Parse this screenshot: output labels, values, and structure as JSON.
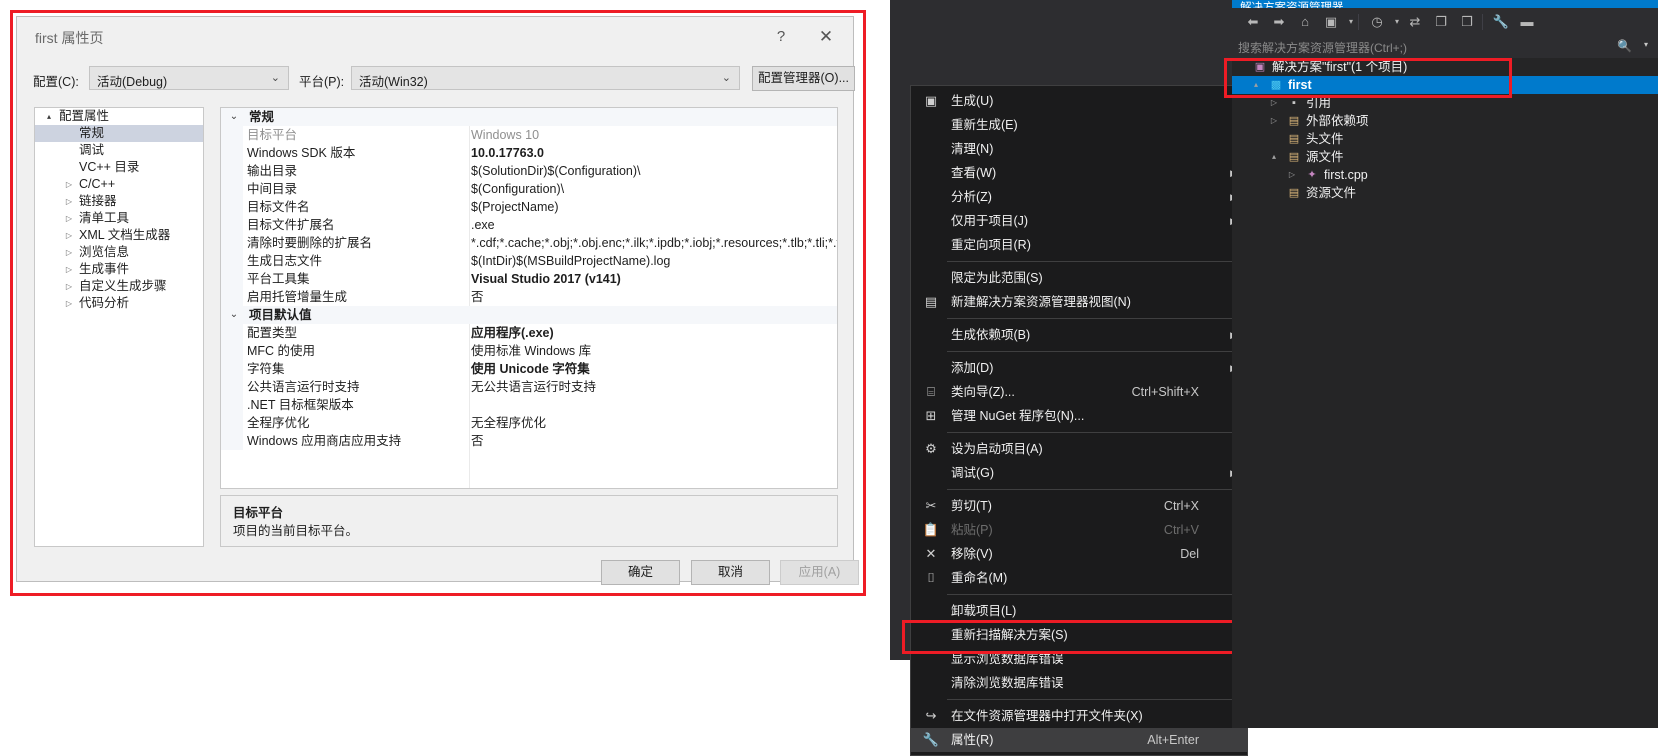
{
  "dialog": {
    "title": "first 属性页",
    "help_icon": "?",
    "close_icon": "✕",
    "config_label": "配置(C):",
    "config_value": "活动(Debug)",
    "platform_label": "平台(P):",
    "platform_value": "活动(Win32)",
    "config_manager_button": "配置管理器(O)...",
    "tree": [
      {
        "label": "配置属性",
        "level": 0,
        "expander": "▴",
        "arrow": "",
        "selected": false
      },
      {
        "label": "常规",
        "level": 1,
        "expander": "",
        "arrow": "",
        "selected": true
      },
      {
        "label": "调试",
        "level": 1,
        "expander": "",
        "arrow": "",
        "selected": false
      },
      {
        "label": "VC++ 目录",
        "level": 1,
        "expander": "",
        "arrow": "",
        "selected": false
      },
      {
        "label": "C/C++",
        "level": 1,
        "expander": "",
        "arrow": "▷",
        "selected": false
      },
      {
        "label": "链接器",
        "level": 1,
        "expander": "",
        "arrow": "▷",
        "selected": false
      },
      {
        "label": "清单工具",
        "level": 1,
        "expander": "",
        "arrow": "▷",
        "selected": false
      },
      {
        "label": "XML 文档生成器",
        "level": 1,
        "expander": "",
        "arrow": "▷",
        "selected": false
      },
      {
        "label": "浏览信息",
        "level": 1,
        "expander": "",
        "arrow": "▷",
        "selected": false
      },
      {
        "label": "生成事件",
        "level": 1,
        "expander": "",
        "arrow": "▷",
        "selected": false
      },
      {
        "label": "自定义生成步骤",
        "level": 1,
        "expander": "",
        "arrow": "▷",
        "selected": false
      },
      {
        "label": "代码分析",
        "level": 1,
        "expander": "",
        "arrow": "▷",
        "selected": false
      }
    ],
    "grid": [
      {
        "kind": "category",
        "label": "常规",
        "chevron": "⌄"
      },
      {
        "kind": "prop",
        "name": "目标平台",
        "value": "Windows 10",
        "bold": false,
        "dim": true
      },
      {
        "kind": "prop",
        "name": "Windows SDK 版本",
        "value": "10.0.17763.0",
        "bold": true,
        "dim": false
      },
      {
        "kind": "prop",
        "name": "输出目录",
        "value": "$(SolutionDir)$(Configuration)\\",
        "bold": false,
        "dim": false
      },
      {
        "kind": "prop",
        "name": "中间目录",
        "value": "$(Configuration)\\",
        "bold": false,
        "dim": false
      },
      {
        "kind": "prop",
        "name": "目标文件名",
        "value": "$(ProjectName)",
        "bold": false,
        "dim": false
      },
      {
        "kind": "prop",
        "name": "目标文件扩展名",
        "value": ".exe",
        "bold": false,
        "dim": false
      },
      {
        "kind": "prop",
        "name": "清除时要删除的扩展名",
        "value": "*.cdf;*.cache;*.obj;*.obj.enc;*.ilk;*.ipdb;*.iobj;*.resources;*.tlb;*.tli;*.t",
        "bold": false,
        "dim": false
      },
      {
        "kind": "prop",
        "name": "生成日志文件",
        "value": "$(IntDir)$(MSBuildProjectName).log",
        "bold": false,
        "dim": false
      },
      {
        "kind": "prop",
        "name": "平台工具集",
        "value": "Visual Studio 2017 (v141)",
        "bold": true,
        "dim": false
      },
      {
        "kind": "prop",
        "name": "启用托管增量生成",
        "value": "否",
        "bold": false,
        "dim": false
      },
      {
        "kind": "category",
        "label": "项目默认值",
        "chevron": "⌄"
      },
      {
        "kind": "prop",
        "name": "配置类型",
        "value": "应用程序(.exe)",
        "bold": true,
        "dim": false
      },
      {
        "kind": "prop",
        "name": "MFC 的使用",
        "value": "使用标准 Windows 库",
        "bold": false,
        "dim": false
      },
      {
        "kind": "prop",
        "name": "字符集",
        "value": "使用 Unicode 字符集",
        "bold": true,
        "dim": false
      },
      {
        "kind": "prop",
        "name": "公共语言运行时支持",
        "value": "无公共语言运行时支持",
        "bold": false,
        "dim": false
      },
      {
        "kind": "prop",
        "name": ".NET 目标框架版本",
        "value": "",
        "bold": false,
        "dim": false
      },
      {
        "kind": "prop",
        "name": "全程序优化",
        "value": "无全程序优化",
        "bold": false,
        "dim": false
      },
      {
        "kind": "prop",
        "name": "Windows 应用商店应用支持",
        "value": "否",
        "bold": false,
        "dim": false
      }
    ],
    "description_title": "目标平台",
    "description_text": "项目的当前目标平台。",
    "ok_button": "确定",
    "cancel_button": "取消",
    "apply_button": "应用(A)"
  },
  "context_menu": [
    {
      "label": "生成(U)",
      "icon": "▣",
      "shortcut": "",
      "submenu": false,
      "disabled": false,
      "highlight": false,
      "separator_after": false
    },
    {
      "label": "重新生成(E)",
      "icon": "",
      "shortcut": "",
      "submenu": false,
      "disabled": false,
      "highlight": false,
      "separator_after": false
    },
    {
      "label": "清理(N)",
      "icon": "",
      "shortcut": "",
      "submenu": false,
      "disabled": false,
      "highlight": false,
      "separator_after": false
    },
    {
      "label": "查看(W)",
      "icon": "",
      "shortcut": "",
      "submenu": true,
      "disabled": false,
      "highlight": false,
      "separator_after": false
    },
    {
      "label": "分析(Z)",
      "icon": "",
      "shortcut": "",
      "submenu": true,
      "disabled": false,
      "highlight": false,
      "separator_after": false
    },
    {
      "label": "仅用于项目(J)",
      "icon": "",
      "shortcut": "",
      "submenu": true,
      "disabled": false,
      "highlight": false,
      "separator_after": false
    },
    {
      "label": "重定向项目(R)",
      "icon": "",
      "shortcut": "",
      "submenu": false,
      "disabled": false,
      "highlight": false,
      "separator_after": true
    },
    {
      "label": "限定为此范围(S)",
      "icon": "",
      "shortcut": "",
      "submenu": false,
      "disabled": false,
      "highlight": false,
      "separator_after": false
    },
    {
      "label": "新建解决方案资源管理器视图(N)",
      "icon": "▤",
      "shortcut": "",
      "submenu": false,
      "disabled": false,
      "highlight": false,
      "separator_after": true
    },
    {
      "label": "生成依赖项(B)",
      "icon": "",
      "shortcut": "",
      "submenu": true,
      "disabled": false,
      "highlight": false,
      "separator_after": true
    },
    {
      "label": "添加(D)",
      "icon": "",
      "shortcut": "",
      "submenu": true,
      "disabled": false,
      "highlight": false,
      "separator_after": false
    },
    {
      "label": "类向导(Z)...",
      "icon": "⌸",
      "shortcut": "Ctrl+Shift+X",
      "submenu": false,
      "disabled": false,
      "highlight": false,
      "separator_after": false
    },
    {
      "label": "管理 NuGet 程序包(N)...",
      "icon": "⊞",
      "shortcut": "",
      "submenu": false,
      "disabled": false,
      "highlight": false,
      "separator_after": true
    },
    {
      "label": "设为启动项目(A)",
      "icon": "⚙",
      "shortcut": "",
      "submenu": false,
      "disabled": false,
      "highlight": false,
      "separator_after": false
    },
    {
      "label": "调试(G)",
      "icon": "",
      "shortcut": "",
      "submenu": true,
      "disabled": false,
      "highlight": false,
      "separator_after": true
    },
    {
      "label": "剪切(T)",
      "icon": "✂",
      "shortcut": "Ctrl+X",
      "submenu": false,
      "disabled": false,
      "highlight": false,
      "separator_after": false
    },
    {
      "label": "粘贴(P)",
      "icon": "📋",
      "shortcut": "Ctrl+V",
      "submenu": false,
      "disabled": true,
      "highlight": false,
      "separator_after": false
    },
    {
      "label": "移除(V)",
      "icon": "✕",
      "shortcut": "Del",
      "submenu": false,
      "disabled": false,
      "highlight": false,
      "separator_after": false
    },
    {
      "label": "重命名(M)",
      "icon": "⌷",
      "shortcut": "",
      "submenu": false,
      "disabled": false,
      "highlight": false,
      "separator_after": true
    },
    {
      "label": "卸载项目(L)",
      "icon": "",
      "shortcut": "",
      "submenu": false,
      "disabled": false,
      "highlight": false,
      "separator_after": false
    },
    {
      "label": "重新扫描解决方案(S)",
      "icon": "",
      "shortcut": "",
      "submenu": false,
      "disabled": false,
      "highlight": false,
      "separator_after": false
    },
    {
      "label": "显示浏览数据库错误",
      "icon": "",
      "shortcut": "",
      "submenu": false,
      "disabled": false,
      "highlight": false,
      "separator_after": false
    },
    {
      "label": "清除浏览数据库错误",
      "icon": "",
      "shortcut": "",
      "submenu": false,
      "disabled": false,
      "highlight": false,
      "separator_after": true
    },
    {
      "label": "在文件资源管理器中打开文件夹(X)",
      "icon": "↪",
      "shortcut": "",
      "submenu": false,
      "disabled": false,
      "highlight": false,
      "separator_after": false
    },
    {
      "label": "属性(R)",
      "icon": "🔧",
      "shortcut": "Alt+Enter",
      "submenu": false,
      "disabled": false,
      "highlight": true,
      "separator_after": false
    }
  ],
  "solution_explorer": {
    "header_title": "解决方案资源管理器",
    "toolbar_icons": [
      "back-icon",
      "forward-icon",
      "home-icon",
      "collapse-all-icon",
      "dropdown-icon",
      "pending-changes-icon",
      "dropdown2-icon",
      "sync-icon",
      "show-all-files-icon",
      "properties-window-icon",
      "wrench-icon",
      "preview-icon"
    ],
    "search_placeholder": "搜索解决方案资源管理器(Ctrl+;)",
    "search_icon": "🔍",
    "search_chevron": "▾",
    "tree": [
      {
        "label": "解决方案\"first\"(1 个项目)",
        "indent": 20,
        "arrow": "",
        "icon": "▣",
        "icon_color": "#c586c0",
        "selected": false
      },
      {
        "label": "first",
        "indent": 36,
        "arrow": "▴",
        "icon": "▩",
        "icon_color": "#4ec9f0",
        "selected": true
      },
      {
        "label": "引用",
        "indent": 54,
        "arrow": "▷",
        "icon": "▪",
        "icon_color": "#c8c8c8",
        "selected": false
      },
      {
        "label": "外部依赖项",
        "indent": 54,
        "arrow": "▷",
        "icon": "▤",
        "icon_color": "#dcb67a",
        "selected": false
      },
      {
        "label": "头文件",
        "indent": 54,
        "arrow": "",
        "icon": "▤",
        "icon_color": "#dcb67a",
        "selected": false
      },
      {
        "label": "源文件",
        "indent": 54,
        "arrow": "▴",
        "icon": "▤",
        "icon_color": "#dcb67a",
        "selected": false
      },
      {
        "label": "first.cpp",
        "indent": 72,
        "arrow": "▷",
        "icon": "✦",
        "icon_color": "#c586c0",
        "selected": false
      },
      {
        "label": "资源文件",
        "indent": 54,
        "arrow": "",
        "icon": "▤",
        "icon_color": "#dcb67a",
        "selected": false
      }
    ]
  },
  "colors": {
    "accent_blue": "#007acc",
    "highlight_red": "#ee1c25",
    "dialog_bg": "#f0f0f0",
    "dark_bg": "#2d2d30",
    "menu_bg": "#1b1b1c"
  }
}
